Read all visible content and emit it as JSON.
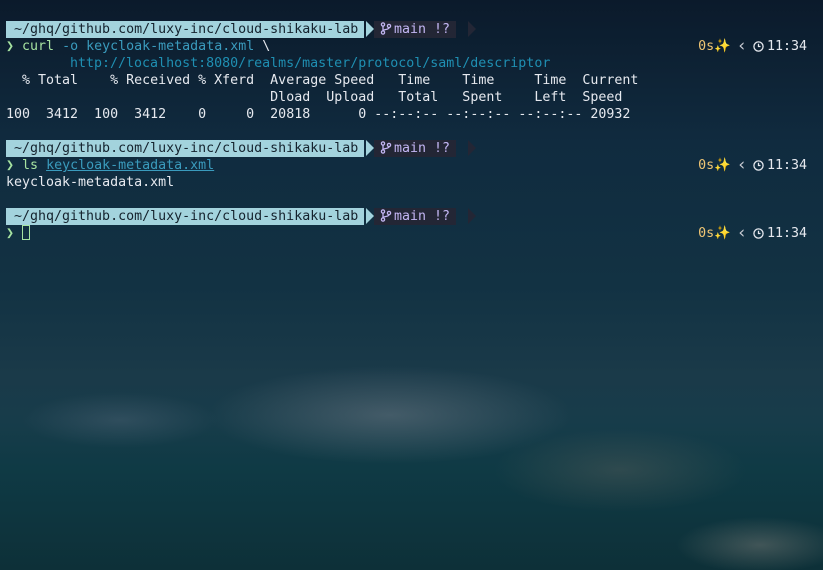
{
  "prompts": [
    {
      "path": "~/ghq/github.com/luxy-inc/cloud-shikaku-lab",
      "branch": "main",
      "status": "!?",
      "prompt_char": "❯",
      "duration": "0s",
      "time": "11:34"
    },
    {
      "path": "~/ghq/github.com/luxy-inc/cloud-shikaku-lab",
      "branch": "main",
      "status": "!?",
      "prompt_char": "❯",
      "duration": "0s",
      "time": "11:34"
    },
    {
      "path": "~/ghq/github.com/luxy-inc/cloud-shikaku-lab",
      "branch": "main",
      "status": "!?",
      "prompt_char": "❯",
      "duration": "0s",
      "time": "11:34"
    }
  ],
  "command1": {
    "name": "curl",
    "flag": "-o",
    "file": "keycloak-metadata.xml",
    "continuation": "\\",
    "url": "http://localhost:8080/realms/master/protocol/saml/descriptor"
  },
  "curl_output": {
    "header1": "  % Total    % Received % Xferd  Average Speed   Time    Time     Time  Current",
    "header2": "                                 Dload  Upload   Total   Spent    Left  Speed",
    "row": "100  3412  100  3412    0     0  20818      0 --:--:-- --:--:-- --:--:-- 20932"
  },
  "command2": {
    "name": "ls",
    "arg": "keycloak-metadata.xml"
  },
  "ls_output": "keycloak-metadata.xml",
  "colors": {
    "path_bg": "#a3d3dd",
    "git_bg": "#232635",
    "prompt_green": "#a6e3a1",
    "duration_yellow": "#f0c674",
    "url_blue": "#1f8fb2"
  }
}
